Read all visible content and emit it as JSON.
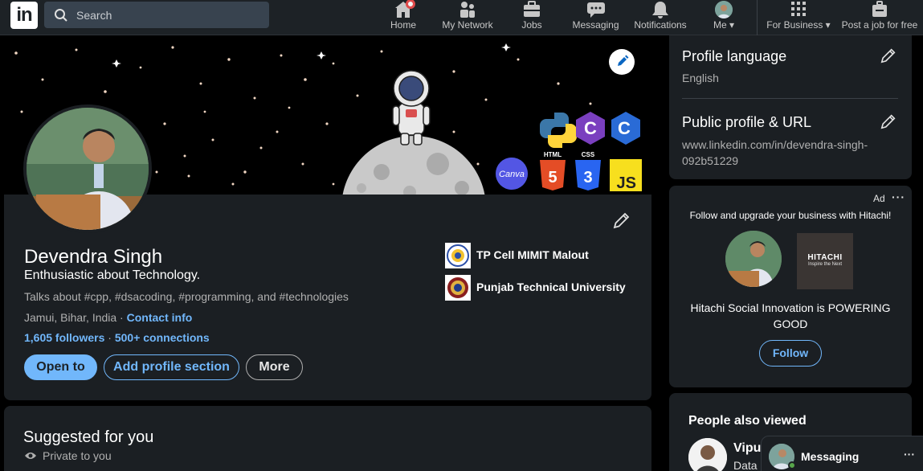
{
  "nav": {
    "logo_text": "in",
    "search_placeholder": "Search",
    "items": [
      {
        "label": "Home",
        "icon": "home-icon"
      },
      {
        "label": "My Network",
        "icon": "network-icon"
      },
      {
        "label": "Jobs",
        "icon": "briefcase-icon"
      },
      {
        "label": "Messaging",
        "icon": "messaging-icon"
      },
      {
        "label": "Notifications",
        "icon": "bell-icon"
      },
      {
        "label": "Me",
        "icon": "avatar"
      },
      {
        "label": "For Business",
        "icon": "grid-icon"
      },
      {
        "label": "Post a job for free",
        "icon": "post-job-icon"
      }
    ]
  },
  "profile": {
    "name": "Devendra Singh",
    "headline": "Enthusiastic about Technology.",
    "talks_about": "Talks about #cpp, #dsacoding, #programming, and #technologies",
    "location": "Jamui, Bihar, India",
    "location_sep": " · ",
    "contact_info": "Contact info",
    "followers": "1,605 followers",
    "stats_sep": " · ",
    "connections": "500+ connections",
    "buttons": {
      "open_to": "Open to",
      "add_section": "Add profile section",
      "more": "More"
    },
    "orgs": [
      {
        "name": "TP Cell MIMIT Malout"
      },
      {
        "name": "Punjab Technical University"
      }
    ],
    "banner_badges": {
      "html": "HTML",
      "css": "CSS",
      "js": "JS",
      "c": "C",
      "canva": "Canva"
    }
  },
  "suggested": {
    "title": "Suggested for you",
    "privacy": "Private to you"
  },
  "sidebar": {
    "language_title": "Profile language",
    "language_value": "English",
    "url_title": "Public profile & URL",
    "url_value": "www.linkedin.com/in/devendra-singh-092b51229"
  },
  "ad": {
    "label": "Ad",
    "dots": "···",
    "tagline": "Follow and upgrade your business with Hitachi!",
    "brand_name": "HITACHI",
    "brand_sub": "Inspire the Next",
    "headline": "Hitachi Social Innovation is POWERING GOOD",
    "follow": "Follow"
  },
  "people": {
    "title": "People also viewed",
    "name": "Vipu",
    "sub": "Data S"
  },
  "messaging": {
    "label": "Messaging",
    "dots": "···"
  },
  "colors": {
    "accent": "#71b7fb",
    "card": "#1b1f23",
    "nav": "#1d2226",
    "page": "#000000"
  }
}
